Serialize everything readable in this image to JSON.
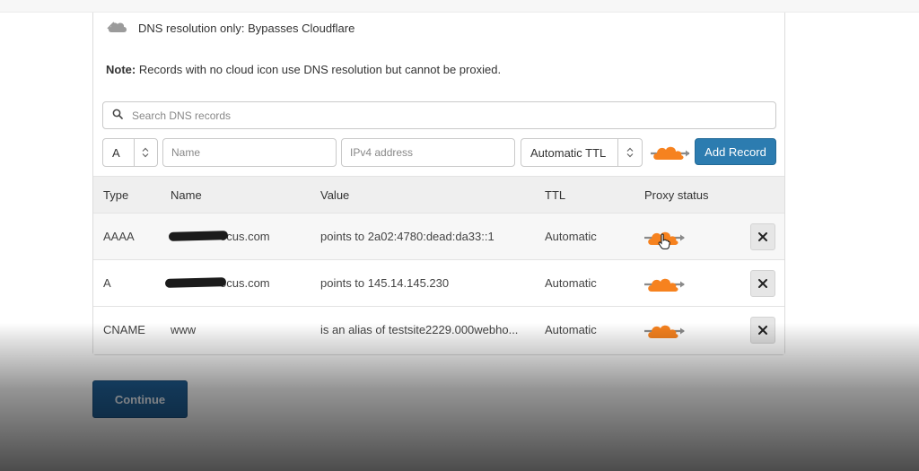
{
  "legend": {
    "text": "DNS resolution only: Bypasses Cloudflare"
  },
  "note": {
    "label": "Note:",
    "text": " Records with no cloud icon use DNS resolution but cannot be proxied."
  },
  "search": {
    "placeholder": "Search DNS records"
  },
  "form": {
    "type_value": "A",
    "name_placeholder": "Name",
    "ipv4_placeholder": "IPv4 address",
    "ttl_value": "Automatic TTL",
    "add_label": "Add Record"
  },
  "table": {
    "headers": [
      "Type",
      "Name",
      "Value",
      "TTL",
      "Proxy status"
    ],
    "rows": [
      {
        "type": "AAAA",
        "name": "ocus.com",
        "value": "points to 2a02:4780:dead:da33::1",
        "ttl": "Automatic"
      },
      {
        "type": "A",
        "name": "ocus.com",
        "value": "points to 145.14.145.230",
        "ttl": "Automatic"
      },
      {
        "type": "CNAME",
        "name": "www",
        "value": "is an alias of testsite2229.000webho...",
        "ttl": "Automatic"
      }
    ]
  },
  "continue_label": "Continue",
  "colors": {
    "proxy_orange": "#f6821f",
    "add_button": "#2c7cb0",
    "continue_button": "#1f5e94"
  },
  "icons": {
    "legend": "gray-cloud-icon",
    "search": "search-icon",
    "proxy": "orange-cloud-arrow-icon",
    "delete": "close-icon",
    "cursor": "hand-pointer-icon"
  }
}
